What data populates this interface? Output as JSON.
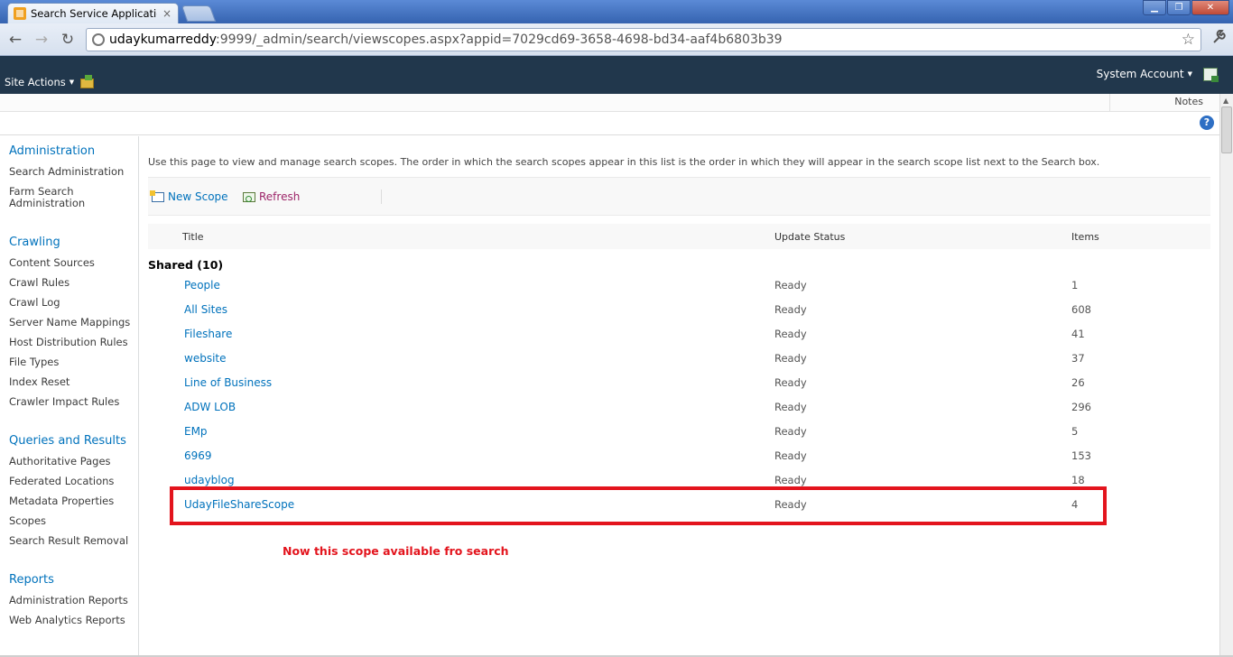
{
  "browser": {
    "tab_title": "Search Service Application: Vi",
    "tab_close": "×",
    "url_host": "udaykumarreddy",
    "url_rest": ":9999/_admin/search/viewscopes.aspx?appid=7029cd69-3658-4698-bd34-aaf4b6803b39",
    "back_icon": "back-arrow-icon",
    "forward_icon": "forward-arrow-icon",
    "reload_icon": "reload-icon",
    "star_icon": "bookmark-star-icon",
    "wrench_icon": "wrench-icon",
    "window_minimize": "▁",
    "window_restore": "❐",
    "window_close": "✕",
    "back_glyph": "←",
    "forward_glyph": "→",
    "reload_glyph": "↻",
    "star_glyph": "☆",
    "wrench_glyph": "🔧"
  },
  "ribbon": {
    "site_actions": "Site Actions",
    "caret": "▼",
    "account": "System Account",
    "background_color": "#21374c"
  },
  "notes_bar": {
    "notes": "Notes",
    "help": "?"
  },
  "quick_launch": {
    "administration": "Administration",
    "search_administration": "Search Administration",
    "farm_search_administration_line1": "Farm Search",
    "farm_search_administration_line2": "Administration",
    "crawling": "Crawling",
    "content_sources": "Content Sources",
    "crawl_rules": "Crawl Rules",
    "crawl_log": "Crawl Log",
    "server_name_mappings": "Server Name Mappings",
    "host_distribution_rules": "Host Distribution Rules",
    "file_types": "File Types",
    "index_reset": "Index Reset",
    "crawler_impact_rules": "Crawler Impact Rules",
    "queries_and_results": "Queries and Results",
    "authoritative_pages": "Authoritative Pages",
    "federated_locations": "Federated Locations",
    "metadata_properties": "Metadata Properties",
    "scopes": "Scopes",
    "search_result_removal": "Search Result Removal",
    "reports": "Reports",
    "administration_reports": "Administration Reports",
    "web_analytics_reports": "Web Analytics Reports"
  },
  "main": {
    "intro": "Use this page to view and manage search scopes. The order in which the search scopes appear in this list is the order in which they will appear in the search scope list next to the Search box.",
    "new_scope": "New Scope",
    "refresh": "Refresh",
    "columns": {
      "title": "Title",
      "update_status": "Update Status",
      "items": "Items"
    },
    "group": "Shared (10)",
    "rows": [
      {
        "title": "People",
        "status": "Ready",
        "items": "1"
      },
      {
        "title": "All Sites",
        "status": "Ready",
        "items": "608"
      },
      {
        "title": "Fileshare",
        "status": "Ready",
        "items": "41"
      },
      {
        "title": "website",
        "status": "Ready",
        "items": "37"
      },
      {
        "title": "Line of Business",
        "status": "Ready",
        "items": "26"
      },
      {
        "title": "ADW LOB",
        "status": "Ready",
        "items": "296"
      },
      {
        "title": "EMp",
        "status": "Ready",
        "items": "5"
      },
      {
        "title": "6969",
        "status": "Ready",
        "items": "153"
      },
      {
        "title": "udayblog",
        "status": "Ready",
        "items": "18"
      },
      {
        "title": "UdayFileShareScope",
        "status": "Ready",
        "items": "4"
      }
    ],
    "annotation": "Now this scope available fro search",
    "highlight_color": "#e3141d",
    "link_color": "#0072bc"
  }
}
